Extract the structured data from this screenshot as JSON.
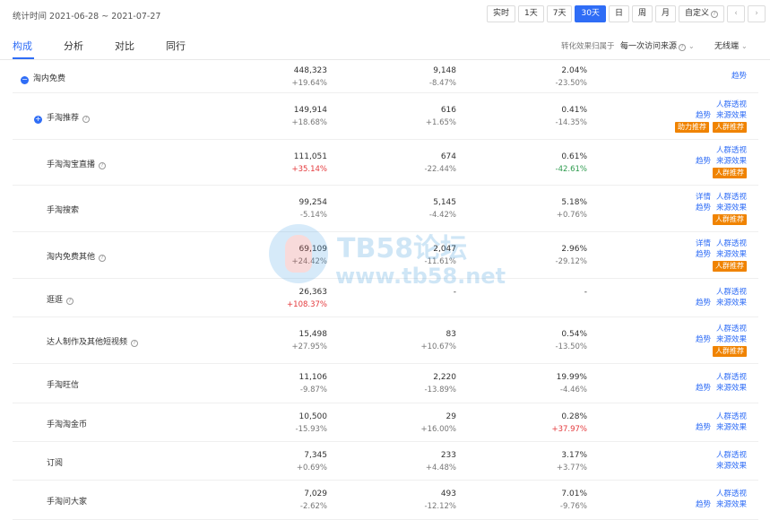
{
  "header": {
    "stat_range": "统计时间 2021-06-28 ~ 2021-07-27",
    "range_buttons": [
      "实时",
      "1天",
      "7天",
      "30天",
      "日",
      "周",
      "月",
      "自定义"
    ],
    "active_range": "30天",
    "prev_icon": "chevron-left-icon",
    "next_icon": "chevron-right-icon"
  },
  "tabs": [
    "构成",
    "分析",
    "对比",
    "同行"
  ],
  "controls": {
    "attribution_label": "转化效果归属于",
    "attribution_value": "每一次访问来源",
    "terminal_value": "无线端"
  },
  "rows": [
    {
      "name": "淘内免费",
      "expand": "−",
      "c1": [
        "448,323",
        "+19.64%"
      ],
      "c2": [
        "9,148",
        "-8.47%"
      ],
      "c3": [
        "2.04%",
        "-23.50%"
      ],
      "c1c": "",
      "c2c": "",
      "c3c": "",
      "actions": [
        [
          "趋势"
        ]
      ],
      "tags": []
    },
    {
      "name": "手淘推荐",
      "expand": "+",
      "help": true,
      "c1": [
        "149,914",
        "+18.68%"
      ],
      "c2": [
        "616",
        "+1.65%"
      ],
      "c3": [
        "0.41%",
        "-14.35%"
      ],
      "c1c": "",
      "c2c": "",
      "c3c": "",
      "actions": [
        [
          "人群透视"
        ],
        [
          "趋势",
          "来源效果"
        ]
      ],
      "tags": [
        "助力推荐",
        "人群推荐"
      ]
    },
    {
      "name": "手淘淘宝直播",
      "help": true,
      "c1": [
        "111,051",
        "+35.14%"
      ],
      "c2": [
        "674",
        "-22.44%"
      ],
      "c3": [
        "0.61%",
        "-42.61%"
      ],
      "c1c": "red",
      "c2c": "",
      "c3c": "green",
      "actions": [
        [
          "人群透视"
        ],
        [
          "趋势",
          "来源效果"
        ]
      ],
      "tags": [
        "人群推荐"
      ]
    },
    {
      "name": "手淘搜索",
      "c1": [
        "99,254",
        "-5.14%"
      ],
      "c2": [
        "5,145",
        "-4.42%"
      ],
      "c3": [
        "5.18%",
        "+0.76%"
      ],
      "c1c": "",
      "c2c": "",
      "c3c": "",
      "actions": [
        [
          "详情",
          "人群透视"
        ],
        [
          "趋势",
          "来源效果"
        ]
      ],
      "tags": [
        "人群推荐"
      ]
    },
    {
      "name": "淘内免费其他",
      "help": true,
      "c1": [
        "69,109",
        "+24.42%"
      ],
      "c2": [
        "2,047",
        "-11.61%"
      ],
      "c3": [
        "2.96%",
        "-29.12%"
      ],
      "c1c": "",
      "c2c": "",
      "c3c": "",
      "actions": [
        [
          "详情",
          "人群透视"
        ],
        [
          "趋势",
          "来源效果"
        ]
      ],
      "tags": [
        "人群推荐"
      ]
    },
    {
      "name": "逛逛",
      "help": true,
      "c1": [
        "26,363",
        "+108.37%"
      ],
      "c2": [
        "-",
        ""
      ],
      "c3": [
        "-",
        ""
      ],
      "c1c": "red",
      "c2c": "",
      "c3c": "",
      "actions": [
        [
          "人群透视"
        ],
        [
          "趋势",
          "来源效果"
        ]
      ],
      "tags": []
    },
    {
      "name": "达人制作及其他短视频",
      "help": true,
      "c1": [
        "15,498",
        "+27.95%"
      ],
      "c2": [
        "83",
        "+10.67%"
      ],
      "c3": [
        "0.54%",
        "-13.50%"
      ],
      "c1c": "",
      "c2c": "",
      "c3c": "",
      "actions": [
        [
          "人群透视"
        ],
        [
          "趋势",
          "来源效果"
        ]
      ],
      "tags": [
        "人群推荐"
      ]
    },
    {
      "name": "手淘旺信",
      "c1": [
        "11,106",
        "-9.87%"
      ],
      "c2": [
        "2,220",
        "-13.89%"
      ],
      "c3": [
        "19.99%",
        "-4.46%"
      ],
      "c1c": "",
      "c2c": "",
      "c3c": "",
      "actions": [
        [
          "人群透视"
        ],
        [
          "趋势",
          "来源效果"
        ]
      ],
      "tags": []
    },
    {
      "name": "手淘淘金币",
      "c1": [
        "10,500",
        "-15.93%"
      ],
      "c2": [
        "29",
        "+16.00%"
      ],
      "c3": [
        "0.28%",
        "+37.97%"
      ],
      "c1c": "",
      "c2c": "",
      "c3c": "red",
      "actions": [
        [
          "人群透视"
        ],
        [
          "趋势",
          "来源效果"
        ]
      ],
      "tags": []
    },
    {
      "name": "订阅",
      "c1": [
        "7,345",
        "+0.69%"
      ],
      "c2": [
        "233",
        "+4.48%"
      ],
      "c3": [
        "3.17%",
        "+3.77%"
      ],
      "c1c": "",
      "c2c": "",
      "c3c": "",
      "actions": [
        [
          "人群透视"
        ],
        [
          "来源效果"
        ]
      ],
      "tags": []
    },
    {
      "name": "手淘问大家",
      "c1": [
        "7,029",
        "-2.62%"
      ],
      "c2": [
        "493",
        "-12.12%"
      ],
      "c3": [
        "7.01%",
        "-9.76%"
      ],
      "c1c": "",
      "c2c": "",
      "c3c": "",
      "actions": [
        [
          "人群透视"
        ],
        [
          "趋势",
          "来源效果"
        ]
      ],
      "tags": []
    }
  ],
  "watermark": {
    "title": "TB58论坛",
    "url": "www.tb58.net"
  }
}
